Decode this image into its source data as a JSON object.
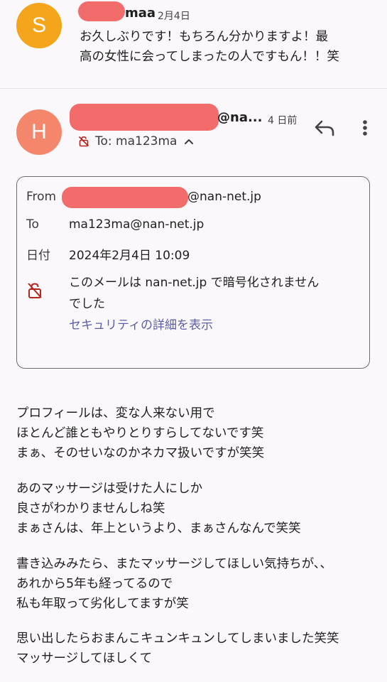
{
  "prev_message": {
    "avatar_letter": "S",
    "avatar_color": "#f4a51c",
    "sender_suffix": "maa",
    "date": "2月4日",
    "preview_line1": "お久しぶりです！もちろん分かりますよ！最",
    "preview_line2": "高の女性に会ってしまったの人ですもん！！笑"
  },
  "message": {
    "avatar_letter": "H",
    "avatar_color": "#f3866b",
    "sender_suffix": "@na...",
    "time_ago": "4 日前",
    "to_line": "To: ma123ma",
    "reply_icon": "reply-icon",
    "more_icon": "more-vert-icon"
  },
  "details": {
    "from_label": "From",
    "from_value_suffix": "@nan-net.jp",
    "to_label": "To",
    "to_value": "ma123ma@nan-net.jp",
    "date_label": "日付",
    "date_value": "2024年2月4日 10:09",
    "encryption_line1": "このメールは nan-net.jp で暗号化されません",
    "encryption_line2": "でした",
    "security_link": "セキュリティの詳細を表示"
  },
  "body": {
    "paragraphs": [
      [
        "プロフィールは、変な人来ない用で",
        "ほとんど誰ともやりとりすらしてないです笑",
        "まぁ、そのせいなのかネカマ扱いですが笑笑"
      ],
      [
        "あのマッサージは受けた人にしか",
        "良さがわかりませんしね笑",
        "まぁさんは、年上というより、まぁさんなんで笑笑"
      ],
      [
        "書き込みみたら、またマッサージしてほしい気持ちが､､",
        "あれから5年も経ってるので",
        "私も年取って劣化してますが笑"
      ],
      [
        "思い出したらおまんこキュンキュンしてしまいました笑笑",
        "マッサージしてほしくて"
      ]
    ]
  },
  "colors": {
    "redaction": "#f26c6c",
    "link": "#5b5ea6",
    "lock_red": "#b3261e"
  }
}
